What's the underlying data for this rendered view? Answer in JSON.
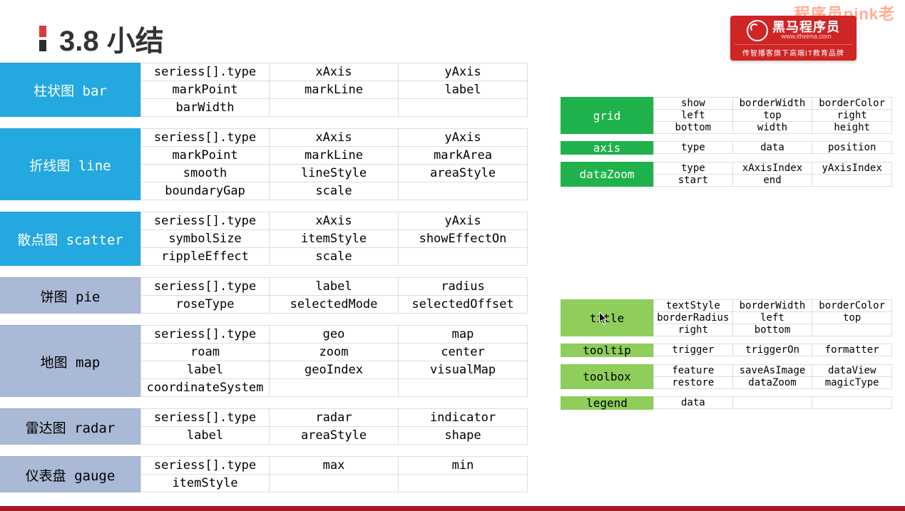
{
  "heading": "3.8 小结",
  "watermark": "程序员pink老",
  "logo": {
    "brand": "黑马程序员",
    "domain": "www.itheima.com",
    "tagline": "传智播客旗下高端IT教育品牌"
  },
  "charts": [
    {
      "label": "柱状图 bar",
      "style": "bright",
      "rows": [
        [
          "seriess[].type",
          "xAxis",
          "yAxis"
        ],
        [
          "markPoint",
          "markLine",
          "label"
        ],
        [
          "barWidth",
          "",
          ""
        ]
      ]
    },
    {
      "label": "折线图 line",
      "style": "bright",
      "rows": [
        [
          "seriess[].type",
          "xAxis",
          "yAxis"
        ],
        [
          "markPoint",
          "markLine",
          "markArea"
        ],
        [
          "smooth",
          "lineStyle",
          "areaStyle"
        ],
        [
          "boundaryGap",
          "scale",
          ""
        ]
      ]
    },
    {
      "label": "散点图 scatter",
      "style": "bright",
      "rows": [
        [
          "seriess[].type",
          "xAxis",
          "yAxis"
        ],
        [
          "symbolSize",
          "itemStyle",
          "showEffectOn"
        ],
        [
          "rippleEffect",
          "scale",
          ""
        ]
      ]
    },
    {
      "label": "饼图 pie",
      "style": "dim",
      "rows": [
        [
          "seriess[].type",
          "label",
          "radius"
        ],
        [
          "roseType",
          "selectedMode",
          "selectedOffset"
        ]
      ]
    },
    {
      "label": "地图 map",
      "style": "dim",
      "rows": [
        [
          "seriess[].type",
          "geo",
          "map"
        ],
        [
          "roam",
          "zoom",
          "center"
        ],
        [
          "label",
          "geoIndex",
          "visualMap"
        ],
        [
          "coordinateSystem",
          "",
          ""
        ]
      ]
    },
    {
      "label": "雷达图 radar",
      "style": "dim",
      "rows": [
        [
          "seriess[].type",
          "radar",
          "indicator"
        ],
        [
          "label",
          "areaStyle",
          "shape"
        ]
      ]
    },
    {
      "label": "仪表盘 gauge",
      "style": "dim",
      "rows": [
        [
          "seriess[].type",
          "max",
          "min"
        ],
        [
          "itemStyle",
          "",
          ""
        ]
      ]
    }
  ],
  "commonA": [
    {
      "label": "grid",
      "style": "g1",
      "rows": [
        [
          "show",
          "borderWidth",
          "borderColor"
        ],
        [
          "left",
          "top",
          "right"
        ],
        [
          "bottom",
          "width",
          "height"
        ]
      ]
    },
    {
      "label": "axis",
      "style": "g1",
      "rows": [
        [
          "type",
          "data",
          "position"
        ]
      ]
    },
    {
      "label": "dataZoom",
      "style": "g1",
      "rows": [
        [
          "type",
          "xAxisIndex",
          "yAxisIndex"
        ],
        [
          "start",
          "end",
          ""
        ]
      ]
    }
  ],
  "commonB": [
    {
      "label": "title",
      "style": "g2",
      "rows": [
        [
          "textStyle",
          "borderWidth",
          "borderColor"
        ],
        [
          "borderRadius",
          "left",
          "top"
        ],
        [
          "right",
          "bottom",
          ""
        ]
      ]
    },
    {
      "label": "tooltip",
      "style": "g2",
      "rows": [
        [
          "trigger",
          "triggerOn",
          "formatter"
        ]
      ]
    },
    {
      "label": "toolbox",
      "style": "g2",
      "rows": [
        [
          "feature",
          "saveAsImage",
          "dataView"
        ],
        [
          "restore",
          "dataZoom",
          "magicType"
        ]
      ]
    },
    {
      "label": "legend",
      "style": "g2",
      "rows": [
        [
          "data",
          "",
          ""
        ]
      ]
    }
  ]
}
